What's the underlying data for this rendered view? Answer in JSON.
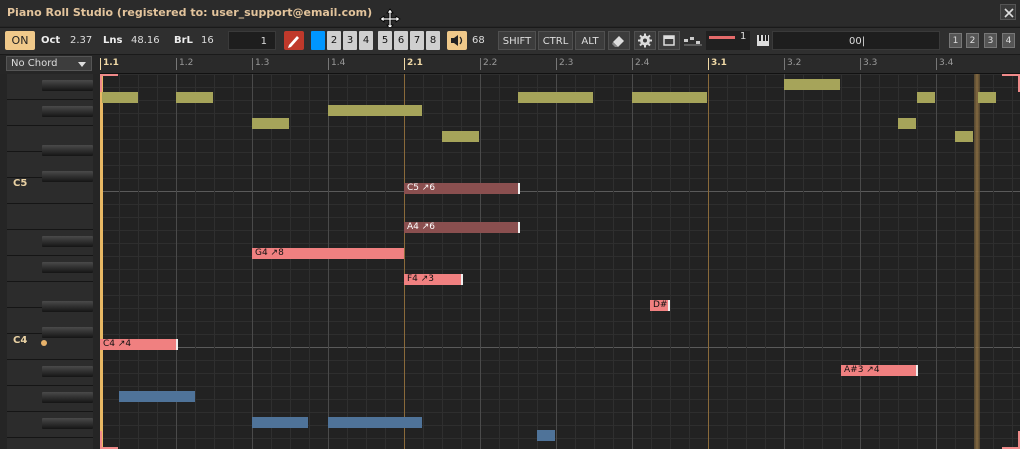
{
  "window": {
    "title": "Piano Roll Studio  (registered to: user_support@email.com)"
  },
  "toolbar": {
    "on_label": "ON",
    "oct_label": "Oct",
    "oct_value": "2.37",
    "lns_label": "Lns",
    "lns_value": "48.16",
    "brl_label": "BrL",
    "brl_value": "16",
    "step_value": "1",
    "quantize": [
      "",
      "2",
      "3",
      "4",
      "5",
      "6",
      "7",
      "8"
    ],
    "volume_value": "68",
    "modifier_keys": [
      "SHIFT",
      "CTRL",
      "ALT"
    ],
    "velocity_value": "1",
    "text_field_value": "00|",
    "slots": [
      "1",
      "2",
      "3",
      "4"
    ],
    "accent_color": "#f0c98a",
    "active_color": "#0096ff"
  },
  "chord": {
    "value": "No Chord"
  },
  "ruler": {
    "labels": [
      {
        "text": "1.1",
        "bar": true
      },
      {
        "text": "1.2",
        "bar": false
      },
      {
        "text": "1.3",
        "bar": false
      },
      {
        "text": "1.4",
        "bar": false
      },
      {
        "text": "2.1",
        "bar": true
      },
      {
        "text": "2.2",
        "bar": false
      },
      {
        "text": "2.3",
        "bar": false
      },
      {
        "text": "2.4",
        "bar": false
      },
      {
        "text": "3.1",
        "bar": true
      },
      {
        "text": "3.2",
        "bar": false
      },
      {
        "text": "3.3",
        "bar": false
      },
      {
        "text": "3.4",
        "bar": false
      }
    ]
  },
  "keys": {
    "c5": "C5",
    "c4": "C4"
  },
  "notes": [
    {
      "label": "C5 ↗6",
      "color": "dark",
      "handle": true
    },
    {
      "label": "A4 ↗6",
      "color": "dark",
      "handle": true
    },
    {
      "label": "G4 ↗8",
      "color": "red",
      "handle": false
    },
    {
      "label": "F4 ↗3",
      "color": "red",
      "handle": true
    },
    {
      "label": "D#",
      "color": "red",
      "handle": true
    },
    {
      "label": "C4 ↗4",
      "color": "red",
      "handle": true
    },
    {
      "label": "A#3 ↗4",
      "color": "red",
      "handle": true
    },
    {
      "label": "",
      "color": "olive"
    },
    {
      "label": "",
      "color": "olive"
    },
    {
      "label": "",
      "color": "olive"
    },
    {
      "label": "",
      "color": "olive"
    },
    {
      "label": "",
      "color": "olive"
    },
    {
      "label": "",
      "color": "olive"
    },
    {
      "label": "",
      "color": "olive"
    },
    {
      "label": "",
      "color": "olive"
    },
    {
      "label": "",
      "color": "olive"
    },
    {
      "label": "",
      "color": "olive"
    },
    {
      "label": "",
      "color": "olive"
    },
    {
      "label": "",
      "color": "olive"
    },
    {
      "label": "",
      "color": "blue"
    },
    {
      "label": "",
      "color": "blue"
    },
    {
      "label": "",
      "color": "blue"
    },
    {
      "label": "",
      "color": "blue"
    }
  ]
}
